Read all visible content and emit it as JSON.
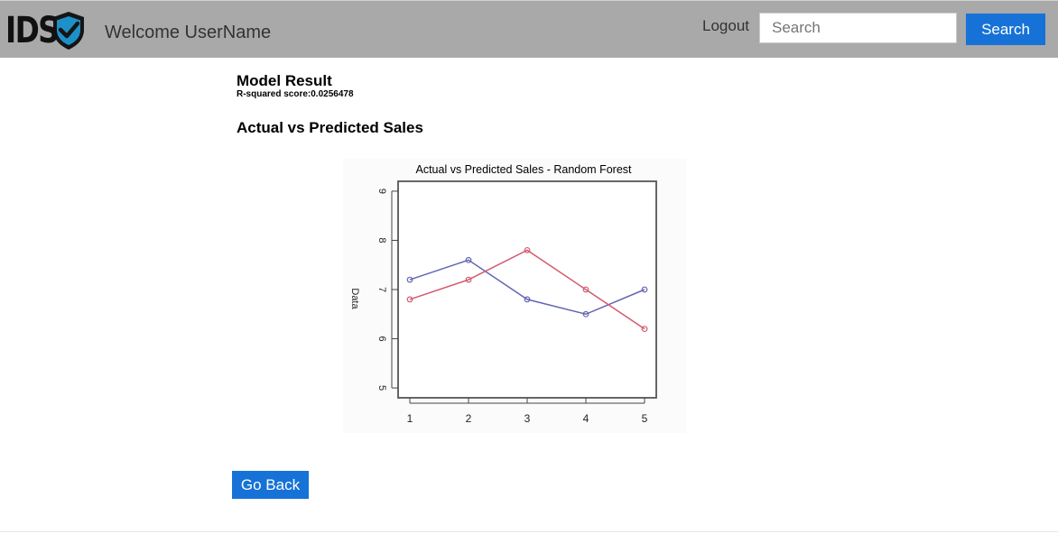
{
  "header": {
    "logo_text": "IDS",
    "welcome": "Welcome UserName",
    "logout_label": "Logout",
    "search_placeholder": "Search",
    "search_value": "",
    "search_button": "Search"
  },
  "main": {
    "model_title": "Model Result",
    "r2_text": "R-squared score:0.0256478",
    "section_title": "Actual vs Predicted Sales",
    "go_back": "Go Back"
  },
  "colors": {
    "header_bg": "#a9a9a9",
    "accent": "#1672d6",
    "series_blue": "#6464b4",
    "series_red": "#d25a6e"
  },
  "chart_data": {
    "type": "line",
    "title": "Actual vs Predicted Sales - Random Forest",
    "xlabel": "",
    "ylabel": "Data",
    "x": [
      1,
      2,
      3,
      4,
      5
    ],
    "series": [
      {
        "color": "#6464b4",
        "values": [
          7.2,
          7.6,
          6.8,
          6.5,
          7.0
        ]
      },
      {
        "color": "#d25a6e",
        "values": [
          6.8,
          7.2,
          7.8,
          7.0,
          6.2
        ]
      }
    ],
    "xlim": [
      0.8,
      5.2
    ],
    "ylim": [
      4.8,
      9.2
    ],
    "xticks": [
      1,
      2,
      3,
      4,
      5
    ],
    "yticks": [
      5,
      6,
      7,
      8,
      9
    ],
    "grid": false,
    "legend": "none"
  }
}
